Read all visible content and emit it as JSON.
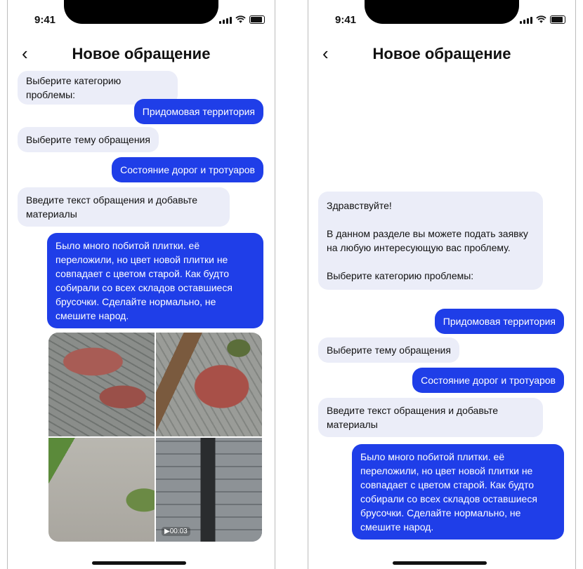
{
  "status": {
    "time": "9:41"
  },
  "header": {
    "title": "Новое обращение",
    "back_icon": "‹"
  },
  "left": {
    "messages": [
      {
        "text": "Выберите категорию проблемы:"
      },
      {
        "text": "Придомовая территория"
      },
      {
        "text": "Выберите тему обращения"
      },
      {
        "text": "Состояние дорог и тротуаров"
      },
      {
        "text": "Введите текст обращения и добавьте материалы"
      },
      {
        "text": "Было много побитой плитки. её переложили, но цвет новой плитки не совпадает с цветом старой. Как будто собирали со всех складов оставшиеся брусочки. Сделайте нормально, не смешите народ."
      }
    ],
    "video_duration": "00:03"
  },
  "right": {
    "messages": [
      {
        "text": "Здравствуйте!\n\nВ данном разделе вы можете подать заявку на любую интересующую вас проблему.\n\nВыберите категорию проблемы:"
      },
      {
        "text": "Придомовая территория"
      },
      {
        "text": "Выберите тему обращения"
      },
      {
        "text": "Состояние дорог и тротуаров"
      },
      {
        "text": "Введите текст обращения и добавьте материалы"
      },
      {
        "text": "Было много побитой плитки. её переложили, но цвет новой плитки не совпадает с цветом старой. Как будто собирали со всех складов оставшиеся брусочки. Сделайте нормально, не смешите народ."
      }
    ]
  },
  "colors": {
    "outgoing": "#1f3ee8",
    "incoming": "#ebedf8"
  }
}
